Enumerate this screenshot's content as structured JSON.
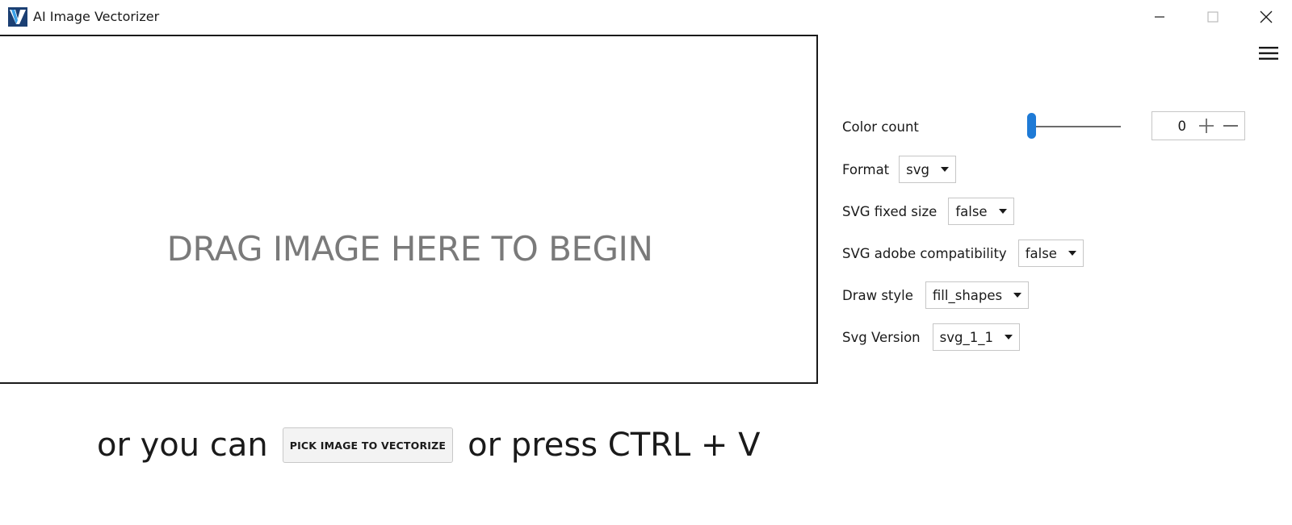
{
  "window": {
    "title": "AI Image Vectorizer",
    "icon": "app-logo-icon",
    "controls": [
      "minimize-icon",
      "maximize-icon",
      "close-icon"
    ]
  },
  "menu": {
    "icon": "hamburger-menu-icon"
  },
  "drop_zone": {
    "text": "DRAG IMAGE HERE TO BEGIN"
  },
  "bottom": {
    "prefix": "or you can",
    "pick_button_label": "PICK IMAGE TO VECTORIZE",
    "suffix": "or press CTRL + V"
  },
  "settings": {
    "color_count": {
      "label": "Color count",
      "value": "0",
      "slider_fraction": 0
    },
    "format": {
      "label": "Format",
      "value": "svg"
    },
    "svg_fixed_size": {
      "label": "SVG fixed size",
      "value": "false"
    },
    "svg_adobe_compat": {
      "label": "SVG adobe compatibility",
      "value": "false"
    },
    "draw_style": {
      "label": "Draw style",
      "value": "fill_shapes"
    },
    "svg_version": {
      "label": "Svg Version",
      "value": "svg_1_1"
    }
  },
  "colors": {
    "accent": "#1e7ad6",
    "drop_text": "#7a7a7a",
    "border": "#1a1a1a"
  }
}
